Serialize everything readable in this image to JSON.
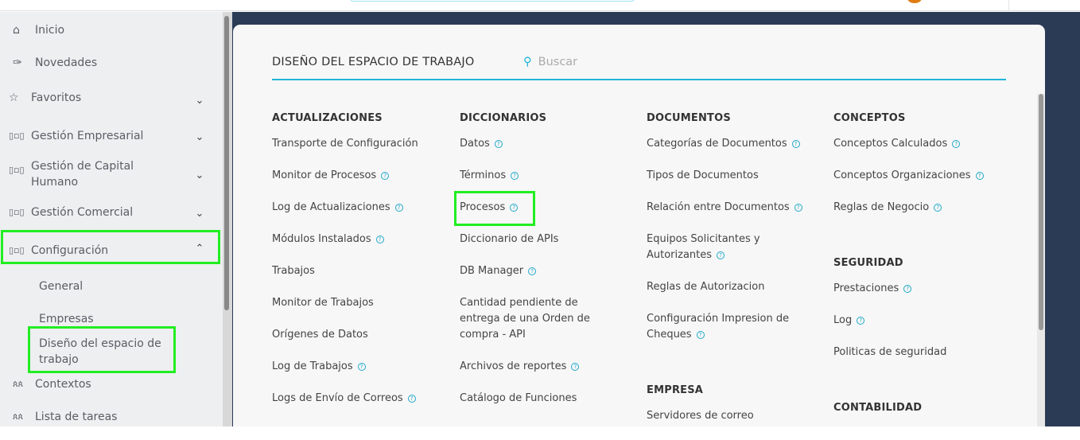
{
  "sidebar": {
    "items": [
      {
        "label": "Inicio",
        "icon": "home-icon"
      },
      {
        "label": "Novedades",
        "icon": "pin-icon"
      },
      {
        "label": "Favoritos",
        "icon": "star-icon"
      },
      {
        "label": "Gestión Empresarial",
        "icon": "chart-icon"
      },
      {
        "label": "Gestión de Capital Humano",
        "icon": "chart-icon"
      },
      {
        "label": "Gestión Comercial",
        "icon": "chart-icon"
      },
      {
        "label": "Configuración",
        "icon": "chart-icon"
      },
      {
        "label": "General"
      },
      {
        "label": "Empresas"
      },
      {
        "label": "Diseño del espacio de trabajo"
      },
      {
        "label": "Contextos",
        "icon": "people-icon"
      },
      {
        "label": "Lista de tareas",
        "icon": "people-icon"
      }
    ]
  },
  "panel": {
    "title": "DISEÑO DEL ESPACIO DE TRABAJO",
    "search_placeholder": "Buscar"
  },
  "columns": [
    {
      "sections": [
        {
          "title": "ACTUALIZACIONES",
          "items": [
            {
              "label": "Transporte de Configuración",
              "help": false
            },
            {
              "label": "Monitor de Procesos",
              "help": true
            },
            {
              "label": "Log de Actualizaciones",
              "help": true
            },
            {
              "label": "Módulos Instalados",
              "help": true
            },
            {
              "label": "Trabajos",
              "help": false
            },
            {
              "label": "Monitor de Trabajos",
              "help": false
            },
            {
              "label": "Orígenes de Datos",
              "help": false
            },
            {
              "label": "Log de Trabajos",
              "help": true
            },
            {
              "label": "Logs de Envío de Correos",
              "help": true
            }
          ]
        }
      ]
    },
    {
      "sections": [
        {
          "title": "DICCIONARIOS",
          "items": [
            {
              "label": "Datos",
              "help": true
            },
            {
              "label": "Términos",
              "help": true
            },
            {
              "label": "Procesos",
              "help": true
            },
            {
              "label": "Diccionario de APIs",
              "help": false
            },
            {
              "label": "DB Manager",
              "help": true
            },
            {
              "label": "Cantidad pendiente de entrega de una Orden de compra - API",
              "help": false
            },
            {
              "label": "Archivos de reportes",
              "help": true
            },
            {
              "label": "Catálogo de Funciones",
              "help": false
            }
          ]
        }
      ]
    },
    {
      "sections": [
        {
          "title": "DOCUMENTOS",
          "items": [
            {
              "label": "Categorías de Documentos",
              "help": true
            },
            {
              "label": "Tipos de Documentos",
              "help": false
            },
            {
              "label": "Relación entre Documentos",
              "help": true
            },
            {
              "label": "Equipos Solicitantes y Autorizantes",
              "help": true
            },
            {
              "label": "Reglas de Autorizacion",
              "help": false
            },
            {
              "label": "Configuración Impresion de Cheques",
              "help": true
            }
          ]
        },
        {
          "title": "EMPRESA",
          "items": [
            {
              "label": "Servidores de correo",
              "help": false
            }
          ]
        }
      ]
    },
    {
      "sections": [
        {
          "title": "CONCEPTOS",
          "items": [
            {
              "label": "Conceptos Calculados",
              "help": true
            },
            {
              "label": "Conceptos Organizaciones",
              "help": true
            },
            {
              "label": "Reglas de Negocio",
              "help": true
            }
          ]
        },
        {
          "title": "SEGURIDAD",
          "items": [
            {
              "label": "Prestaciones",
              "help": true
            },
            {
              "label": "Log",
              "help": true
            },
            {
              "label": "Politicas de seguridad",
              "help": false
            }
          ]
        },
        {
          "title": "CONTABILIDAD",
          "items": []
        }
      ]
    }
  ],
  "colors": {
    "accent": "#1fb5d6",
    "highlight": "#22ee22",
    "background": "#2b3a55"
  }
}
